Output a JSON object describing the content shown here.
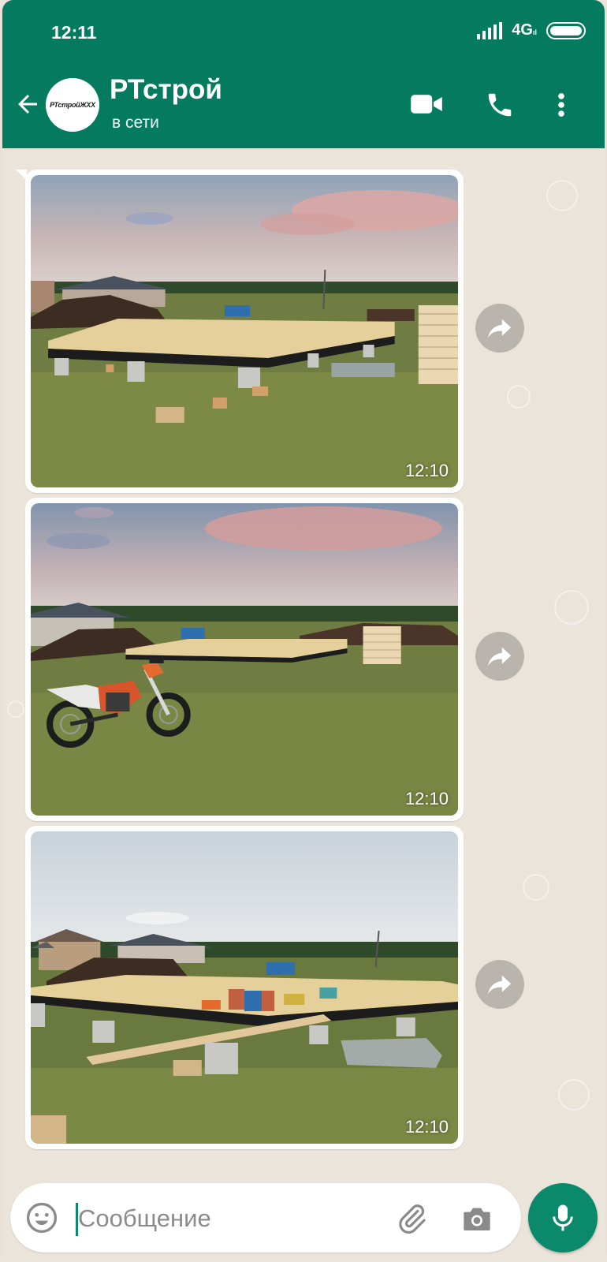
{
  "status_bar": {
    "time": "12:11",
    "network": "4G",
    "network_sub": "ıl"
  },
  "chat": {
    "title": "РТстрой",
    "status": "в сети",
    "avatar_text": "РТстройЖХХ"
  },
  "messages": [
    {
      "type": "photo",
      "time": "12:10",
      "scene": "floor-platform-wide"
    },
    {
      "type": "photo",
      "time": "12:10",
      "scene": "motorcycle-and-platform"
    },
    {
      "type": "photo",
      "time": "12:10",
      "scene": "floor-platform-with-tools"
    }
  ],
  "input": {
    "placeholder": "Сообщение"
  },
  "icons": {
    "back": "arrow-left-icon",
    "video": "video-camera-icon",
    "call": "phone-icon",
    "menu": "more-vert-icon",
    "forward": "forward-icon",
    "emoji": "emoji-icon",
    "attach": "paperclip-icon",
    "camera": "camera-icon",
    "mic": "microphone-icon"
  },
  "colors": {
    "header": "#047a5e",
    "accent": "#0a8a6a",
    "chat_bg": "#ebe4da"
  }
}
